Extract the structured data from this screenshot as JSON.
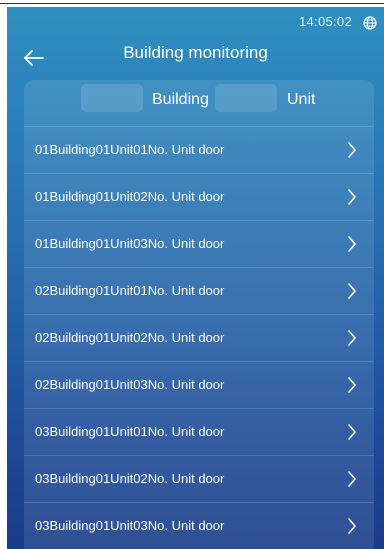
{
  "status_bar": {
    "time": "14:05:02",
    "icon": "globe-icon"
  },
  "header": {
    "title": "Building monitoring",
    "back_icon": "arrow-left-icon"
  },
  "filters": {
    "building_label": "Building",
    "unit_label": "Unit"
  },
  "doors": [
    {
      "label": "01Building01Unit01No. Unit door"
    },
    {
      "label": "01Building01Unit02No. Unit door"
    },
    {
      "label": "01Building01Unit03No. Unit door"
    },
    {
      "label": "02Building01Unit01No. Unit door"
    },
    {
      "label": "02Building01Unit02No. Unit door"
    },
    {
      "label": "02Building01Unit03No. Unit door"
    },
    {
      "label": "03Building01Unit01No. Unit door"
    },
    {
      "label": "03Building01Unit02No. Unit door"
    },
    {
      "label": "03Building01Unit03No. Unit door"
    }
  ],
  "colors": {
    "background_top": "#2f8fc0",
    "background_bottom": "#183c88",
    "text": "#ffffff"
  }
}
